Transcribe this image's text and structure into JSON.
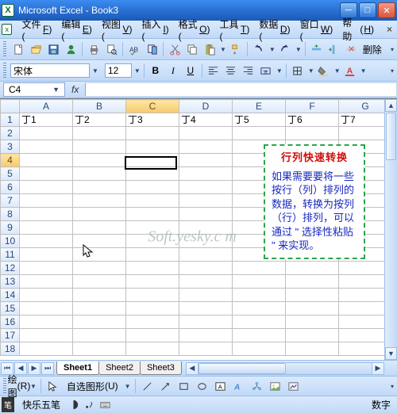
{
  "titlebar": {
    "title": "Microsoft Excel - Book3"
  },
  "menus": [
    {
      "label": "文件",
      "u": "F"
    },
    {
      "label": "编辑",
      "u": "E"
    },
    {
      "label": "视图",
      "u": "V"
    },
    {
      "label": "插入",
      "u": "I"
    },
    {
      "label": "格式",
      "u": "O"
    },
    {
      "label": "工具",
      "u": "T"
    },
    {
      "label": "数据",
      "u": "D"
    },
    {
      "label": "窗口",
      "u": "W"
    }
  ],
  "menu_help": {
    "label": "帮助",
    "u": "H"
  },
  "toolbar1": {
    "delete_label": "删除"
  },
  "format": {
    "font": "宋体",
    "size": "12"
  },
  "namebox": {
    "value": "C4"
  },
  "columns": [
    "A",
    "B",
    "C",
    "D",
    "E",
    "F",
    "G"
  ],
  "rows": [
    1,
    2,
    3,
    4,
    5,
    6,
    7,
    8,
    9,
    10,
    11,
    12,
    13,
    14,
    15,
    16,
    17,
    18
  ],
  "row1": [
    "丁1",
    "丁2",
    "丁3",
    "丁4",
    "丁5",
    "丁6",
    "丁7"
  ],
  "active_cell": {
    "col": "C",
    "row": 4
  },
  "selected_col_idx": 2,
  "selected_row_idx": 3,
  "tip": {
    "title": "行列快速转换",
    "body": "如果需要要将一些按行（列）排列的数据，转换为按列（行）排列，可以通过 \" 选择性粘贴 \" 来实现。"
  },
  "tabs": [
    "Sheet1",
    "Sheet2",
    "Sheet3"
  ],
  "active_tab": 0,
  "drawing": {
    "label": "绘图",
    "u": "R",
    "autoshape": "自选图形",
    "autoshape_u": "U"
  },
  "status": {
    "ime": "快乐五笔",
    "mode_label": "数字"
  },
  "watermark": "Soft.yesky.c m"
}
